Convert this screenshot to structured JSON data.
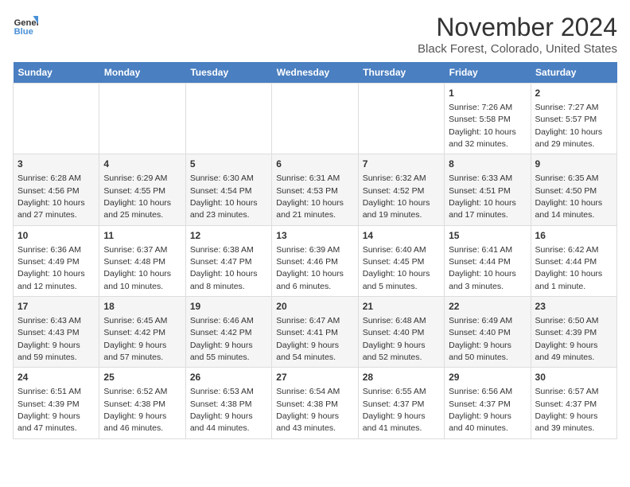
{
  "logo": {
    "text_general": "General",
    "text_blue": "Blue"
  },
  "title": "November 2024",
  "subtitle": "Black Forest, Colorado, United States",
  "days_of_week": [
    "Sunday",
    "Monday",
    "Tuesday",
    "Wednesday",
    "Thursday",
    "Friday",
    "Saturday"
  ],
  "weeks": [
    [
      {
        "day": "",
        "detail": ""
      },
      {
        "day": "",
        "detail": ""
      },
      {
        "day": "",
        "detail": ""
      },
      {
        "day": "",
        "detail": ""
      },
      {
        "day": "",
        "detail": ""
      },
      {
        "day": "1",
        "detail": "Sunrise: 7:26 AM\nSunset: 5:58 PM\nDaylight: 10 hours and 32 minutes."
      },
      {
        "day": "2",
        "detail": "Sunrise: 7:27 AM\nSunset: 5:57 PM\nDaylight: 10 hours and 29 minutes."
      }
    ],
    [
      {
        "day": "3",
        "detail": "Sunrise: 6:28 AM\nSunset: 4:56 PM\nDaylight: 10 hours and 27 minutes."
      },
      {
        "day": "4",
        "detail": "Sunrise: 6:29 AM\nSunset: 4:55 PM\nDaylight: 10 hours and 25 minutes."
      },
      {
        "day": "5",
        "detail": "Sunrise: 6:30 AM\nSunset: 4:54 PM\nDaylight: 10 hours and 23 minutes."
      },
      {
        "day": "6",
        "detail": "Sunrise: 6:31 AM\nSunset: 4:53 PM\nDaylight: 10 hours and 21 minutes."
      },
      {
        "day": "7",
        "detail": "Sunrise: 6:32 AM\nSunset: 4:52 PM\nDaylight: 10 hours and 19 minutes."
      },
      {
        "day": "8",
        "detail": "Sunrise: 6:33 AM\nSunset: 4:51 PM\nDaylight: 10 hours and 17 minutes."
      },
      {
        "day": "9",
        "detail": "Sunrise: 6:35 AM\nSunset: 4:50 PM\nDaylight: 10 hours and 14 minutes."
      }
    ],
    [
      {
        "day": "10",
        "detail": "Sunrise: 6:36 AM\nSunset: 4:49 PM\nDaylight: 10 hours and 12 minutes."
      },
      {
        "day": "11",
        "detail": "Sunrise: 6:37 AM\nSunset: 4:48 PM\nDaylight: 10 hours and 10 minutes."
      },
      {
        "day": "12",
        "detail": "Sunrise: 6:38 AM\nSunset: 4:47 PM\nDaylight: 10 hours and 8 minutes."
      },
      {
        "day": "13",
        "detail": "Sunrise: 6:39 AM\nSunset: 4:46 PM\nDaylight: 10 hours and 6 minutes."
      },
      {
        "day": "14",
        "detail": "Sunrise: 6:40 AM\nSunset: 4:45 PM\nDaylight: 10 hours and 5 minutes."
      },
      {
        "day": "15",
        "detail": "Sunrise: 6:41 AM\nSunset: 4:44 PM\nDaylight: 10 hours and 3 minutes."
      },
      {
        "day": "16",
        "detail": "Sunrise: 6:42 AM\nSunset: 4:44 PM\nDaylight: 10 hours and 1 minute."
      }
    ],
    [
      {
        "day": "17",
        "detail": "Sunrise: 6:43 AM\nSunset: 4:43 PM\nDaylight: 9 hours and 59 minutes."
      },
      {
        "day": "18",
        "detail": "Sunrise: 6:45 AM\nSunset: 4:42 PM\nDaylight: 9 hours and 57 minutes."
      },
      {
        "day": "19",
        "detail": "Sunrise: 6:46 AM\nSunset: 4:42 PM\nDaylight: 9 hours and 55 minutes."
      },
      {
        "day": "20",
        "detail": "Sunrise: 6:47 AM\nSunset: 4:41 PM\nDaylight: 9 hours and 54 minutes."
      },
      {
        "day": "21",
        "detail": "Sunrise: 6:48 AM\nSunset: 4:40 PM\nDaylight: 9 hours and 52 minutes."
      },
      {
        "day": "22",
        "detail": "Sunrise: 6:49 AM\nSunset: 4:40 PM\nDaylight: 9 hours and 50 minutes."
      },
      {
        "day": "23",
        "detail": "Sunrise: 6:50 AM\nSunset: 4:39 PM\nDaylight: 9 hours and 49 minutes."
      }
    ],
    [
      {
        "day": "24",
        "detail": "Sunrise: 6:51 AM\nSunset: 4:39 PM\nDaylight: 9 hours and 47 minutes."
      },
      {
        "day": "25",
        "detail": "Sunrise: 6:52 AM\nSunset: 4:38 PM\nDaylight: 9 hours and 46 minutes."
      },
      {
        "day": "26",
        "detail": "Sunrise: 6:53 AM\nSunset: 4:38 PM\nDaylight: 9 hours and 44 minutes."
      },
      {
        "day": "27",
        "detail": "Sunrise: 6:54 AM\nSunset: 4:38 PM\nDaylight: 9 hours and 43 minutes."
      },
      {
        "day": "28",
        "detail": "Sunrise: 6:55 AM\nSunset: 4:37 PM\nDaylight: 9 hours and 41 minutes."
      },
      {
        "day": "29",
        "detail": "Sunrise: 6:56 AM\nSunset: 4:37 PM\nDaylight: 9 hours and 40 minutes."
      },
      {
        "day": "30",
        "detail": "Sunrise: 6:57 AM\nSunset: 4:37 PM\nDaylight: 9 hours and 39 minutes."
      }
    ]
  ]
}
